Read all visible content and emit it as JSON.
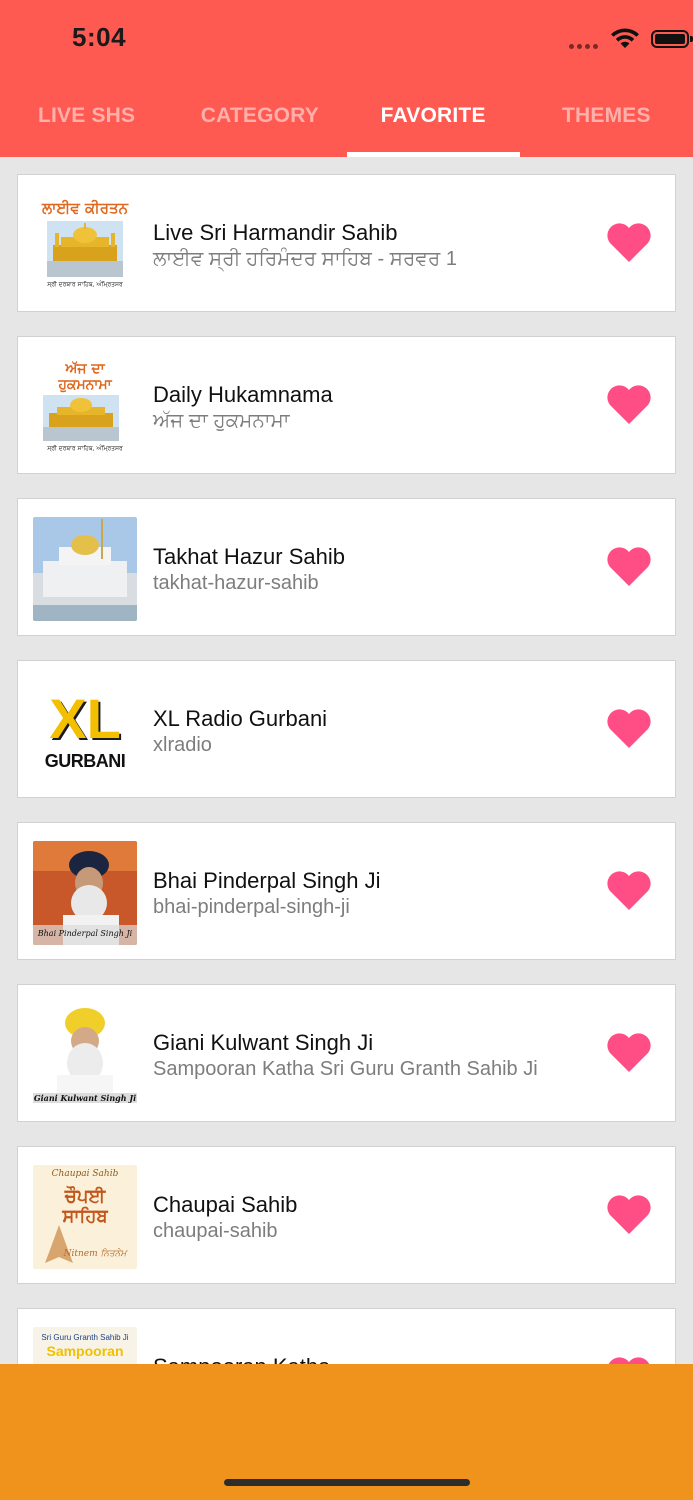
{
  "status_bar": {
    "time": "5:04"
  },
  "tabs": [
    {
      "label": "LIVE SHS",
      "active": false
    },
    {
      "label": "CATEGORY",
      "active": false
    },
    {
      "label": "FAVORITE",
      "active": true
    },
    {
      "label": "THEMES",
      "active": false
    }
  ],
  "colors": {
    "header": "#fe5a52",
    "heart": "#ff4d86",
    "bottom_bar": "#f0931d"
  },
  "favorites": [
    {
      "title": "Live Sri Harmandir Sahib",
      "subtitle": "ਲਾਈਵ ਸ੍ਰੀ ਹਰਿਮੰਦਰ ਸਾਹਿਬ - ਸਰਵਰ 1",
      "thumb_caption": "ਲਾਈਵ ਕੀਰਤਨ",
      "thumb_footer": "ਸ੍ਰੀ ਦਰਬਾਰ ਸਾਹਿਬ, ਅੰਮ੍ਰਿਤਸਰ",
      "icon": "heart-icon"
    },
    {
      "title": "Daily Hukamnama",
      "subtitle": "ਅੱਜ ਦਾ ਹੁਕਮਨਾਮਾ",
      "thumb_caption": "ਅੱਜ ਦਾ ਹੁਕਮਨਾਮਾ",
      "thumb_footer": "ਸ੍ਰੀ ਦਰਬਾਰ ਸਾਹਿਬ, ਅੰਮ੍ਰਿਤਸਰ",
      "icon": "heart-icon"
    },
    {
      "title": "Takhat Hazur Sahib",
      "subtitle": "takhat-hazur-sahib",
      "icon": "heart-icon"
    },
    {
      "title": "XL Radio Gurbani",
      "subtitle": "xlradio",
      "thumb_logo_top": "XL",
      "thumb_logo_bottom": "GURBANI",
      "icon": "heart-icon"
    },
    {
      "title": "Bhai Pinderpal Singh Ji",
      "subtitle": "bhai-pinderpal-singh-ji",
      "thumb_caption": "Bhai Pinderpal Singh Ji",
      "icon": "heart-icon"
    },
    {
      "title": "Giani Kulwant Singh Ji",
      "subtitle": "Sampooran Katha Sri Guru Granth Sahib Ji",
      "thumb_caption": "Giani Kulwant Singh Ji",
      "icon": "heart-icon"
    },
    {
      "title": "Chaupai Sahib",
      "subtitle": "chaupai-sahib",
      "thumb_caption": "Chaupai Sahib",
      "thumb_title": "ਚੌਪਈ ਸਾਹਿਬ",
      "thumb_footer": "Nitnem ਨਿਤਨੇਮ",
      "icon": "heart-icon"
    },
    {
      "title": "Sampooran Katha",
      "subtitle": "",
      "thumb_caption": "Sri Guru Granth Sahib Ji",
      "thumb_title": "Sampooran",
      "icon": "heart-icon"
    }
  ]
}
